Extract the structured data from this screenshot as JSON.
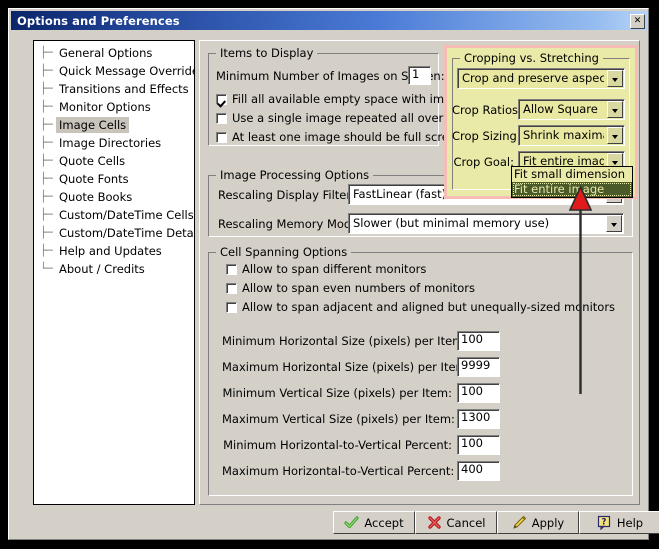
{
  "window": {
    "title": "Options and Preferences",
    "close_label": "✕"
  },
  "sidebar": {
    "items": [
      {
        "label": "General Options",
        "selected": false
      },
      {
        "label": "Quick Message Override",
        "selected": false
      },
      {
        "label": "Transitions and Effects",
        "selected": false
      },
      {
        "label": "Monitor Options",
        "selected": false
      },
      {
        "label": "Image Cells",
        "selected": true
      },
      {
        "label": "Image Directories",
        "selected": false
      },
      {
        "label": "Quote Cells",
        "selected": false
      },
      {
        "label": "Quote Fonts",
        "selected": false
      },
      {
        "label": "Quote Books",
        "selected": false
      },
      {
        "label": "Custom/DateTime Cells",
        "selected": false
      },
      {
        "label": "Custom/DateTime Details",
        "selected": false
      },
      {
        "label": "Help and Updates",
        "selected": false
      },
      {
        "label": "About / Credits",
        "selected": false
      }
    ]
  },
  "items_to_display": {
    "group_title": "Items to Display",
    "min_images_label": "Minimum Number of Images on Screen:",
    "min_images_value": "1",
    "checkboxes": [
      {
        "label": "Fill all available empty space with images",
        "checked": true
      },
      {
        "label": "Use a single image repeated all over",
        "checked": false
      },
      {
        "label": "At least one image should be full screen",
        "checked": false
      }
    ]
  },
  "cropping": {
    "group_title": "Cropping vs. Stretching",
    "mode_value": "Crop and preserve aspect",
    "crop_ratios_label": "Crop Ratios:",
    "crop_ratios_value": "Allow Square",
    "crop_sizing_label": "Crop Sizing:",
    "crop_sizing_value": "Shrink maximally",
    "crop_goal_label": "Crop Goal:",
    "crop_goal_value": "Fit entire image",
    "highlight_color": "#f6bcb6",
    "panel_color": "#e9e9a8"
  },
  "dropdown": {
    "options": [
      {
        "label": "Fit small dimension",
        "selected": false
      },
      {
        "label": "Fit entire image",
        "selected": true
      }
    ],
    "selected_bg": "#4a5a28"
  },
  "image_processing": {
    "group_title": "Image Processing Options",
    "display_filter_label": "Rescaling Display Filter",
    "display_filter_value": "FastLinear (fast)",
    "memory_mode_label": "Rescaling Memory Mode",
    "memory_mode_value": "Slower (but minimal memory use)"
  },
  "cell_spanning": {
    "group_title": "Cell Spanning Options",
    "checkboxes": [
      {
        "label": "Allow to span different monitors",
        "checked": false
      },
      {
        "label": "Allow to span even numbers of monitors",
        "checked": false
      },
      {
        "label": "Allow to span adjacent and aligned but unequally-sized monitors",
        "checked": false
      }
    ],
    "fields": [
      {
        "label": "Minimum Horizontal Size (pixels) per Item:",
        "value": "100"
      },
      {
        "label": "Maximum Horizontal Size (pixels) per Item:",
        "value": "9999"
      },
      {
        "label": "Minimum Vertical Size (pixels) per Item:",
        "value": "100"
      },
      {
        "label": "Maximum Vertical Size (pixels) per Item:",
        "value": "1300"
      },
      {
        "label": "Minimum Horizontal-to-Vertical  Percent:",
        "value": "100"
      },
      {
        "label": "Maximum Horizontal-to-Vertical  Percent:",
        "value": "400"
      }
    ]
  },
  "buttons": [
    {
      "label": "Accept",
      "icon": "green-check-icon"
    },
    {
      "label": "Cancel",
      "icon": "red-x-icon"
    },
    {
      "label": "Apply",
      "icon": "pencil-icon"
    },
    {
      "label": "Help",
      "icon": "question-balloon-icon"
    }
  ],
  "annotation": {
    "type": "red-up-arrow",
    "color": "#e01b1b"
  }
}
